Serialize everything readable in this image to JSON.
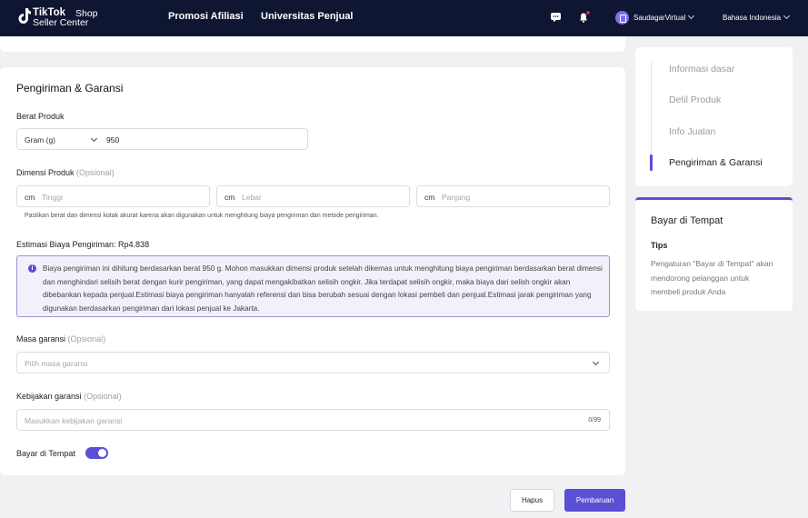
{
  "header": {
    "logo_brand": "TikTok",
    "logo_shop": "Shop",
    "logo_sub": "Seller Center",
    "nav": [
      "Promosi Afiliasi",
      "Universitas Penjual"
    ],
    "icons": [
      "chat-icon",
      "bell-icon"
    ],
    "user_name": "SaudagarVirtual",
    "language": "Bahasa Indonesia"
  },
  "section": {
    "title": "Pengiriman & Garansi",
    "weight": {
      "label": "Berat Produk",
      "unit": "Gram (g)",
      "value": "950"
    },
    "dimensions": {
      "label": "Dimensi Produk",
      "optional": "(Opsional)",
      "fields": [
        {
          "unit": "cm",
          "placeholder": "Tinggi"
        },
        {
          "unit": "cm",
          "placeholder": "Lebar"
        },
        {
          "unit": "cm",
          "placeholder": "Panjang"
        }
      ],
      "note": "Pastikan berat dan dimensi kotak akurat karena akan digunakan untuk menghitung biaya pengiriman dan metode pengiriman."
    },
    "shipping_estimate": {
      "label": "Estimasi Biaya Pengiriman: Rp4.838",
      "info": "Biaya pengiriman ini dihitung berdasarkan berat 950 g. Mohon masukkan dimensi produk setelah dikemas untuk menghitung biaya pengiriman berdasarkan berat dimensi dan menghindari selisih berat dengan kurir pengiriman, yang dapat mengakibatkan selisih ongkir. Jika terdapat selisih ongkir, maka biaya dari selish ongkir akan dibebankan kepada penjual.Estimasi biaya pengiriman hanyalah referensi dan bisa berubah sesuai dengan lokasi pembeli dan penjual.Estimasi jarak pengiriman yang digunakan berdasarkan pengiriman dari lokasi penjual ke Jakarta."
    },
    "warranty_period": {
      "label": "Masa garansi",
      "optional": "(Opsional)",
      "placeholder": "Pilih masa garansi"
    },
    "warranty_policy": {
      "label": "Kebijakan garansi",
      "optional": "(Opsional)",
      "placeholder": "Masukkan kebijakan garansi",
      "counter": "0/99"
    },
    "cod": {
      "label": "Bayar di Tempat",
      "enabled": true
    }
  },
  "actions": {
    "delete": "Hapus",
    "update": "Pembaruan"
  },
  "side_nav": {
    "items": [
      "Informasi dasar",
      "Detil Produk",
      "Info Jualan",
      "Pengiriman & Garansi"
    ],
    "active": "Pengiriman & Garansi"
  },
  "side_help": {
    "title": "Bayar di Tempat",
    "tips_label": "Tips",
    "tips_text": "Pengaturan \"Bayar di Tempat\" akan mendorong pelanggan untuk membeli produk Anda"
  },
  "colors": {
    "accent": "#5b4fd6",
    "header_bg": "#0f1632",
    "page_bg": "#f1f1f4"
  }
}
